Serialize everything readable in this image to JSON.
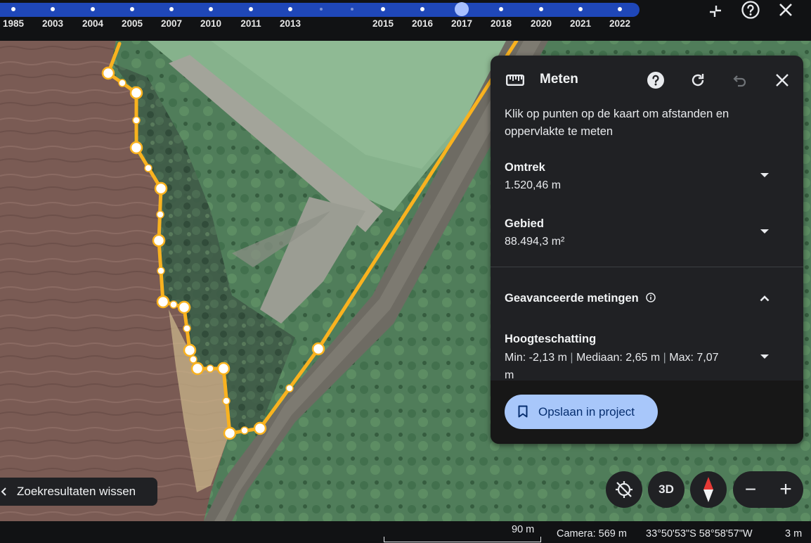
{
  "timeline": {
    "years": [
      "1985",
      "2003",
      "2004",
      "2005",
      "2007",
      "2010",
      "2011",
      "2013",
      "2015",
      "2016",
      "2017",
      "2018",
      "2020",
      "2021",
      "2022"
    ],
    "selected_year": "2017"
  },
  "top_controls": {
    "icons": [
      "collapse-icon",
      "help-icon",
      "close-icon"
    ]
  },
  "measure_panel": {
    "title": "Meten",
    "hint": "Klik op punten op de kaart om afstanden en oppervlakte te meten",
    "perimeter_label": "Omtrek",
    "perimeter_value": "1.520,46 m",
    "area_label": "Gebied",
    "area_value": "88.494,3 m²",
    "advanced_label": "Geavanceerde metingen",
    "height_label": "Hoogteschatting",
    "height_min": "Min: -2,13 m",
    "height_median": "Mediaan: 2,65 m",
    "height_max": "Max: 7,07 m",
    "separator": "|",
    "save_label": "Opslaan in project"
  },
  "clear_results_label": "Zoekresultaten wissen",
  "map_controls": {
    "three_d_label": "3D",
    "zoom_out": "−",
    "zoom_in": "+"
  },
  "status_bar": {
    "scale": "90 m",
    "camera": "Camera: 569 m",
    "coordinates": "33°50'53\"S 58°58'57\"W",
    "elevation": "3 m"
  },
  "colors": {
    "measure_line": "#f9b21f",
    "timeline": "#1f47b8",
    "panel_bg": "#202124",
    "save_button": "#a8c7fa"
  }
}
